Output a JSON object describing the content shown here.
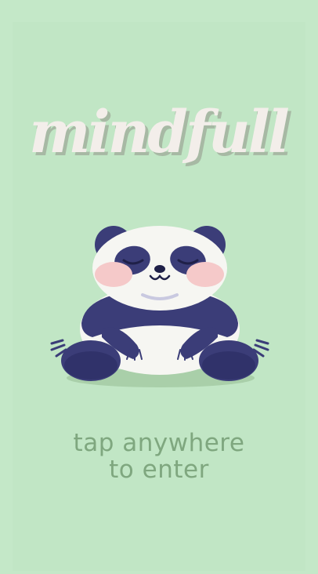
{
  "app": {
    "logo_text": "mindfull",
    "cta_line1": "tap anywhere",
    "cta_line2": "to enter"
  },
  "icons": {
    "mascot": "sleeping-panda-icon"
  },
  "colors": {
    "background": "#c4e8c8",
    "logo_fill": "#f3eeea",
    "logo_shadow": "#a7b9a4",
    "cta_text": "#7fa77f",
    "panda_dark": "#3b3d78",
    "panda_white": "#f6f6f2",
    "panda_cheek": "#f5c9c9"
  }
}
